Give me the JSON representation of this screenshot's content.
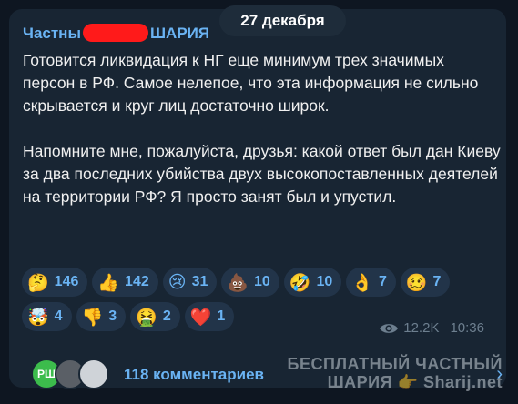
{
  "channel": {
    "name_start": "Частны",
    "name_end": "ШАРИЯ"
  },
  "date_badge": "27 декабря",
  "message": {
    "paragraph1": "Готовится ликвидация к НГ еще минимум трех значимых персон в РФ. Самое нелепое, что эта информация не сильно скрывается и круг лиц достаточно широк.",
    "paragraph2": "Напомните мне, пожалуйста, друзья: какой ответ был дан Киеву за два последних убийства двух высокопоставленных деятелей на территории РФ? Я просто занят был и упустил."
  },
  "reactions": [
    {
      "emoji": "🤔",
      "count": "146"
    },
    {
      "emoji": "👍",
      "count": "142"
    },
    {
      "emoji": "😢",
      "count": "31"
    },
    {
      "emoji": "💩",
      "count": "10"
    },
    {
      "emoji": "🤣",
      "count": "10"
    },
    {
      "emoji": "👌",
      "count": "7"
    },
    {
      "emoji": "🥴",
      "count": "7"
    },
    {
      "emoji": "🤯",
      "count": "4"
    },
    {
      "emoji": "👎",
      "count": "3"
    },
    {
      "emoji": "🤮",
      "count": "2"
    },
    {
      "emoji": "❤️",
      "count": "1"
    }
  ],
  "meta": {
    "views": "12.2K",
    "time": "10:36"
  },
  "comments": {
    "avatar1_initials": "РШ",
    "label": "118 комментариев"
  },
  "watermark": {
    "line1": "БЕСПЛАТНЫЙ ЧАСТНЫЙ",
    "line2": "ШАРИЯ 👉 Sharij.net"
  },
  "colors": {
    "background": "#0e1621",
    "bubble": "#182533",
    "accent": "#6ab3f3",
    "redaction": "#ff1a1a"
  }
}
